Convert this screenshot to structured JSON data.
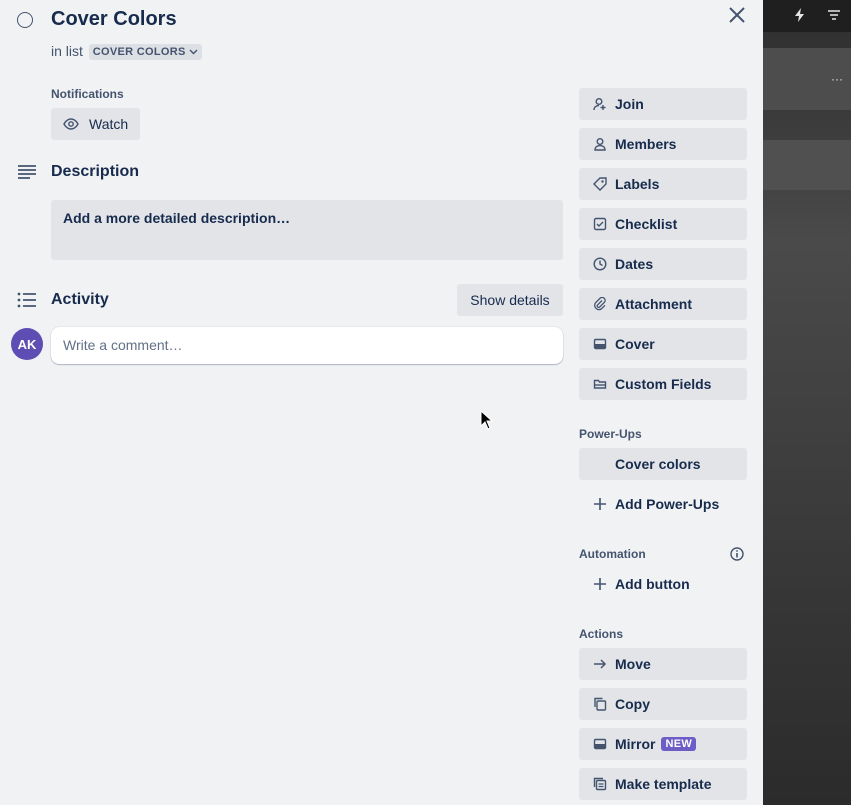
{
  "card": {
    "title": "Cover Colors",
    "in_list_prefix": "in list",
    "list_name": "COVER COLORS"
  },
  "notifications": {
    "label": "Notifications",
    "watch_label": "Watch"
  },
  "description": {
    "title": "Description",
    "placeholder": "Add a more detailed description…"
  },
  "activity": {
    "title": "Activity",
    "show_details_label": "Show details",
    "comment_placeholder": "Write a comment…",
    "avatar_initials": "AK"
  },
  "sidebar": {
    "add_to_card": [
      {
        "label": "Join",
        "icon": "join-icon"
      },
      {
        "label": "Members",
        "icon": "person-icon"
      },
      {
        "label": "Labels",
        "icon": "label-icon"
      },
      {
        "label": "Checklist",
        "icon": "checklist-icon"
      },
      {
        "label": "Dates",
        "icon": "clock-icon"
      },
      {
        "label": "Attachment",
        "icon": "paperclip-icon"
      },
      {
        "label": "Cover",
        "icon": "cover-icon"
      },
      {
        "label": "Custom Fields",
        "icon": "custom-fields-icon"
      }
    ],
    "powerups": {
      "heading": "Power-Ups",
      "items": [
        "Cover colors"
      ],
      "add_label": "Add Power-Ups"
    },
    "automation": {
      "heading": "Automation",
      "add_button_label": "Add button"
    },
    "actions": {
      "heading": "Actions",
      "items": [
        {
          "label": "Move",
          "icon": "arrow-right-icon"
        },
        {
          "label": "Copy",
          "icon": "copy-icon"
        },
        {
          "label": "Mirror",
          "icon": "mirror-icon",
          "badge": "NEW"
        },
        {
          "label": "Make template",
          "icon": "template-icon"
        }
      ]
    }
  },
  "colors": {
    "modal_bg": "#f1f2f4",
    "button_bg": "#e2e4e8",
    "text": "#172b4d",
    "avatar": "#5e4db2",
    "new_badge": "#6e5dc6"
  }
}
